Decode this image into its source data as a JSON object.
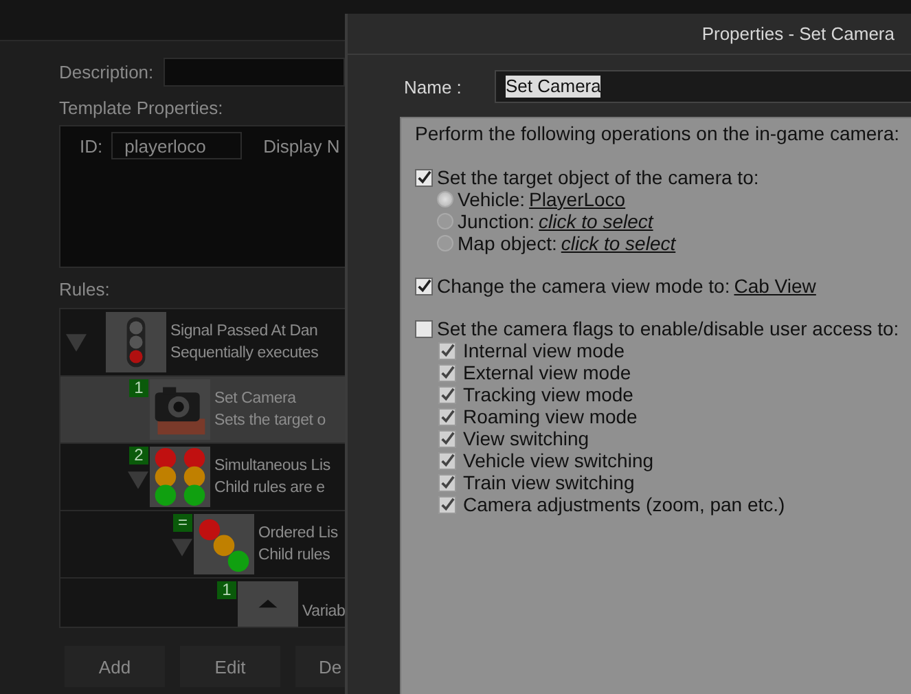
{
  "editor": {
    "description_label": "Description:",
    "template_properties_label": "Template Properties:",
    "id_label": "ID:",
    "id_value": "playerloco",
    "display_label": "Display N",
    "rules_label": "Rules:",
    "rules": [
      {
        "kind": "signal",
        "title": "Signal Passed At Dan",
        "subtitle": "Sequentially executes",
        "selected": false,
        "expanded": true,
        "children": [
          {
            "badge": "1",
            "kind": "camera",
            "title": "Set Camera",
            "subtitle": "Sets the target o",
            "selected": true
          },
          {
            "badge": "2",
            "kind": "simultaneous",
            "title": "Simultaneous Lis",
            "subtitle": "Child rules are e",
            "selected": false,
            "expanded": true,
            "children": [
              {
                "badge": "=",
                "kind": "ordered",
                "title": "Ordered Lis",
                "subtitle": "Child rules",
                "selected": false,
                "expanded": true,
                "children": [
                  {
                    "badge": "1",
                    "kind": "variable",
                    "title": "Variab",
                    "selected": false
                  }
                ]
              }
            ]
          }
        ]
      }
    ],
    "buttons": [
      "Add",
      "Edit",
      "De"
    ]
  },
  "dialog": {
    "title": "Properties - Set Camera",
    "name_label": "Name :",
    "name_value": "Set Camera",
    "intro": "Perform the following operations on the in-game camera:",
    "sections": [
      {
        "label": "Set the target object of the camera to:",
        "checked": true,
        "options": [
          {
            "label": "Vehicle:",
            "link": "PlayerLoco",
            "italic": false,
            "selected": true
          },
          {
            "label": "Junction:",
            "link": "click to select",
            "italic": true,
            "selected": false
          },
          {
            "label": "Map object:",
            "link": "click to select",
            "italic": true,
            "selected": false
          }
        ]
      },
      {
        "label": "Change the camera view mode to:",
        "link": "Cab View",
        "checked": true
      },
      {
        "label": "Set the camera flags to enable/disable user access to:",
        "checked": false,
        "flags": [
          {
            "label": "Internal view mode",
            "checked": true
          },
          {
            "label": "External view mode",
            "checked": true
          },
          {
            "label": "Tracking view mode",
            "checked": true
          },
          {
            "label": "Roaming view mode",
            "checked": true
          },
          {
            "label": "View switching",
            "checked": true
          },
          {
            "label": "Vehicle view switching",
            "checked": true
          },
          {
            "label": "Train view switching",
            "checked": true
          },
          {
            "label": "Camera adjustments (zoom, pan etc.)",
            "checked": true
          }
        ]
      }
    ]
  }
}
